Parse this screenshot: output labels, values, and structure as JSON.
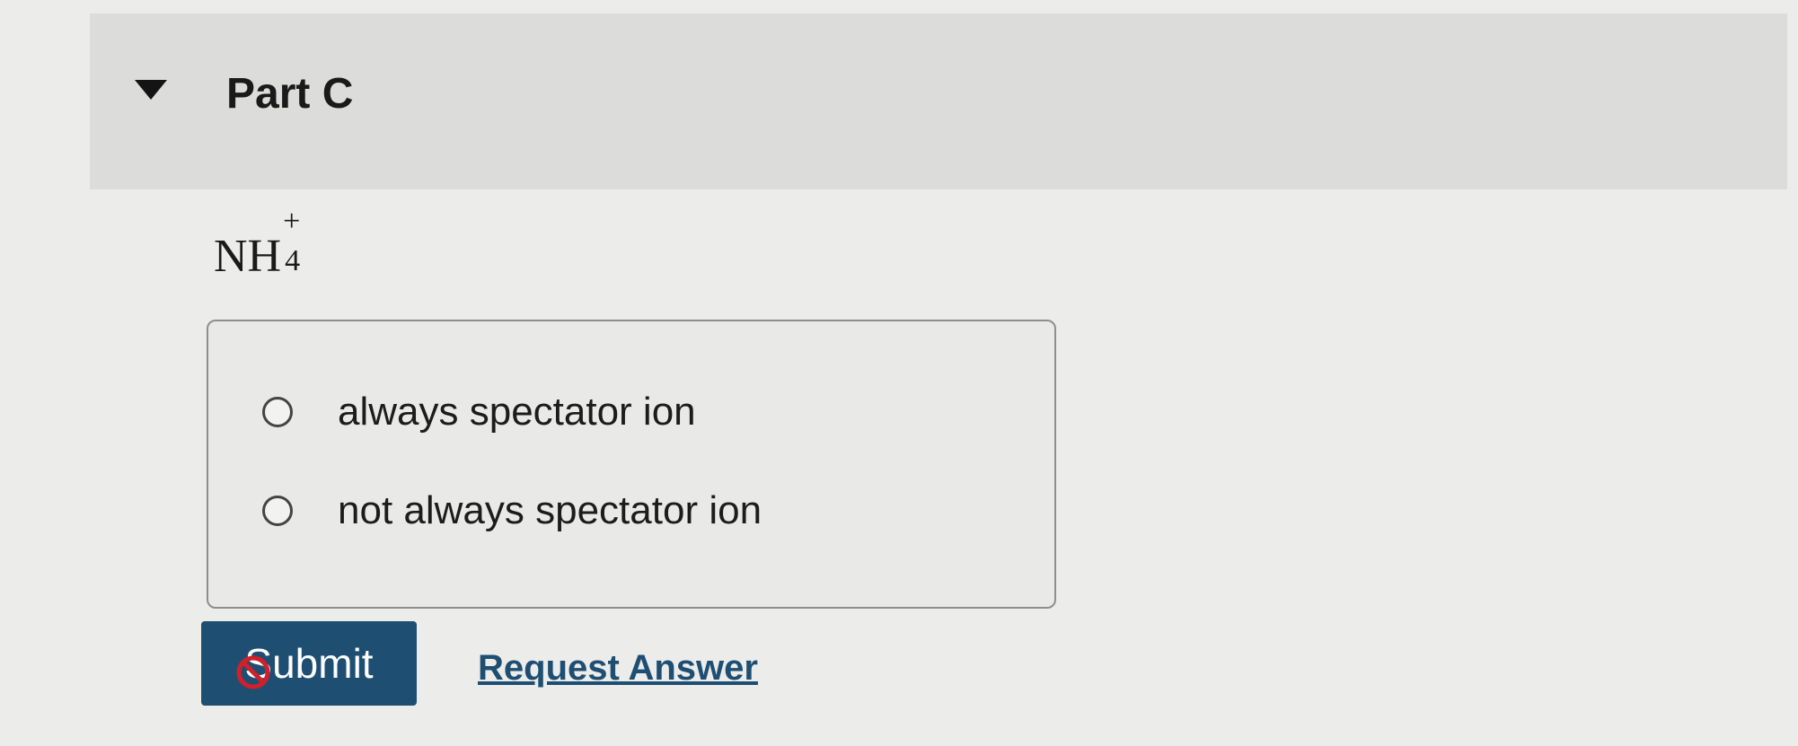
{
  "part": {
    "title": "Part C",
    "toggle_icon": "triangle-down-icon"
  },
  "question": {
    "formula_base": "NH",
    "formula_superscript": "+",
    "formula_subscript": "4"
  },
  "options": [
    {
      "label": "always spectator ion",
      "selected": false
    },
    {
      "label": "not always spectator ion",
      "selected": false
    }
  ],
  "actions": {
    "submit_label": "Submit",
    "submit_state": "disabled",
    "submit_overlay_icon": "not-allowed-icon",
    "request_answer_label": "Request Answer"
  },
  "colors": {
    "accent": "#1f4e73",
    "header_bg": "#dcdddb",
    "page_bg": "#ecedea",
    "blocked": "#d0202a"
  }
}
